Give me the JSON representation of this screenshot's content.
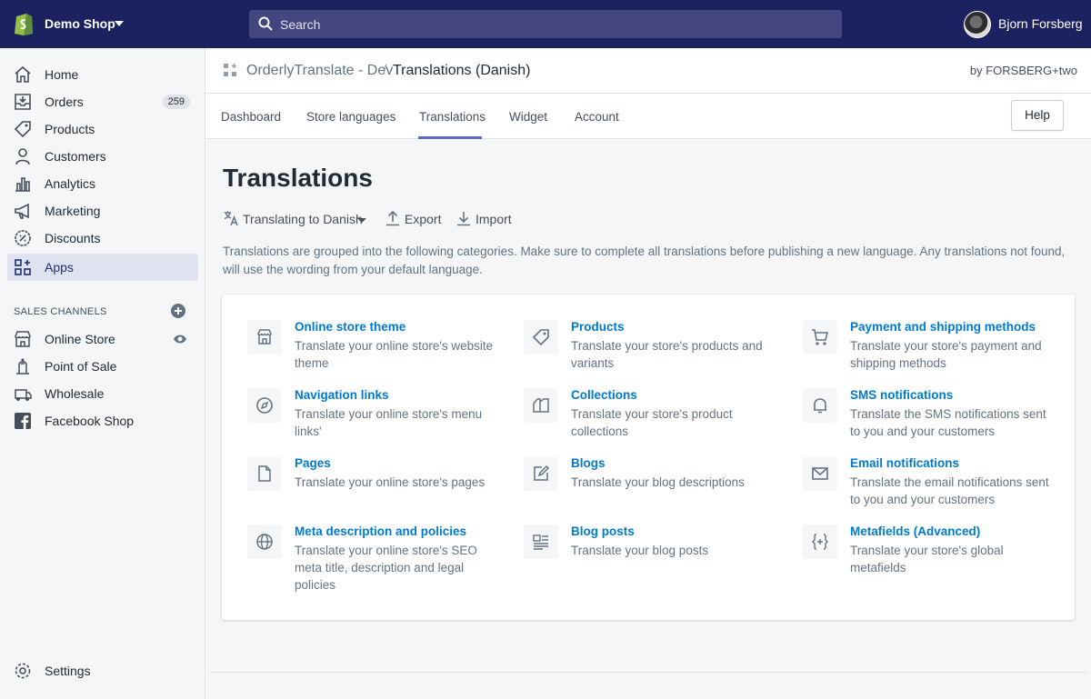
{
  "topbar": {
    "shop_name": "Demo Shop",
    "search_placeholder": "Search",
    "user_name": "Bjorn Forsberg"
  },
  "sidebar": {
    "items": [
      {
        "label": "Home",
        "icon": "home-icon"
      },
      {
        "label": "Orders",
        "icon": "orders-icon",
        "badge": "259"
      },
      {
        "label": "Products",
        "icon": "tag-icon"
      },
      {
        "label": "Customers",
        "icon": "person-icon"
      },
      {
        "label": "Analytics",
        "icon": "bar-chart-icon"
      },
      {
        "label": "Marketing",
        "icon": "megaphone-icon"
      },
      {
        "label": "Discounts",
        "icon": "discount-icon"
      },
      {
        "label": "Apps",
        "icon": "apps-icon",
        "active": true
      }
    ],
    "sales_channels_title": "SALES CHANNELS",
    "channels": [
      {
        "label": "Online Store",
        "icon": "store-icon"
      },
      {
        "label": "Point of Sale",
        "icon": "pos-icon"
      },
      {
        "label": "Wholesale",
        "icon": "wholesale-icon"
      },
      {
        "label": "Facebook Shop",
        "icon": "facebook-icon"
      }
    ],
    "settings_label": "Settings"
  },
  "appbar": {
    "app_name": "OrderlyTranslate - Dev",
    "separator": "/",
    "page_name": "Translations (Danish)",
    "byline": "by FORSBERG+two"
  },
  "tabs": {
    "items": [
      "Dashboard",
      "Store languages",
      "Translations",
      "Widget",
      "Account"
    ],
    "active": "Translations",
    "help_label": "Help"
  },
  "page": {
    "title": "Translations",
    "actions": {
      "translating": "Translating to Danish",
      "export": "Export",
      "import": "Import"
    },
    "description": "Translations are grouped into the following categories. Make sure to complete all translations before publishing a new language. Any translations not found, will use the wording from your default language."
  },
  "categories": [
    {
      "title": "Online store theme",
      "desc": "Translate your online store's website theme",
      "icon": "theme-icon"
    },
    {
      "title": "Products",
      "desc": "Translate your store's products and variants",
      "icon": "tag-icon"
    },
    {
      "title": "Payment and shipping methods",
      "desc": "Translate your store's payment and shipping methods",
      "icon": "cart-icon"
    },
    {
      "title": "Navigation links",
      "desc": "Translate your online store's menu links'",
      "icon": "compass-icon"
    },
    {
      "title": "Collections",
      "desc": "Translate your store's product collections",
      "icon": "collections-icon"
    },
    {
      "title": "SMS notifications",
      "desc": "Translate the SMS notifications sent to you and your customers",
      "icon": "bell-icon"
    },
    {
      "title": "Pages",
      "desc": "Translate your online store's pages",
      "icon": "page-icon"
    },
    {
      "title": "Blogs",
      "desc": "Translate your blog descriptions",
      "icon": "compose-icon"
    },
    {
      "title": "Email notifications",
      "desc": "Translate the email notifications sent to you and your customers",
      "icon": "envelope-icon"
    },
    {
      "title": "Meta description and policies",
      "desc": "Translate your online store's SEO meta title, description and legal policies",
      "icon": "globe-icon"
    },
    {
      "title": "Blog posts",
      "desc": "Translate your blog posts",
      "icon": "blog-posts-icon"
    },
    {
      "title": "Metafields (Advanced)",
      "desc": "Translate your store's global metafields",
      "icon": "code-icon"
    }
  ],
  "colors": {
    "topbar": "#1c2260",
    "link": "#007ace",
    "accent": "#5c6ac4"
  }
}
